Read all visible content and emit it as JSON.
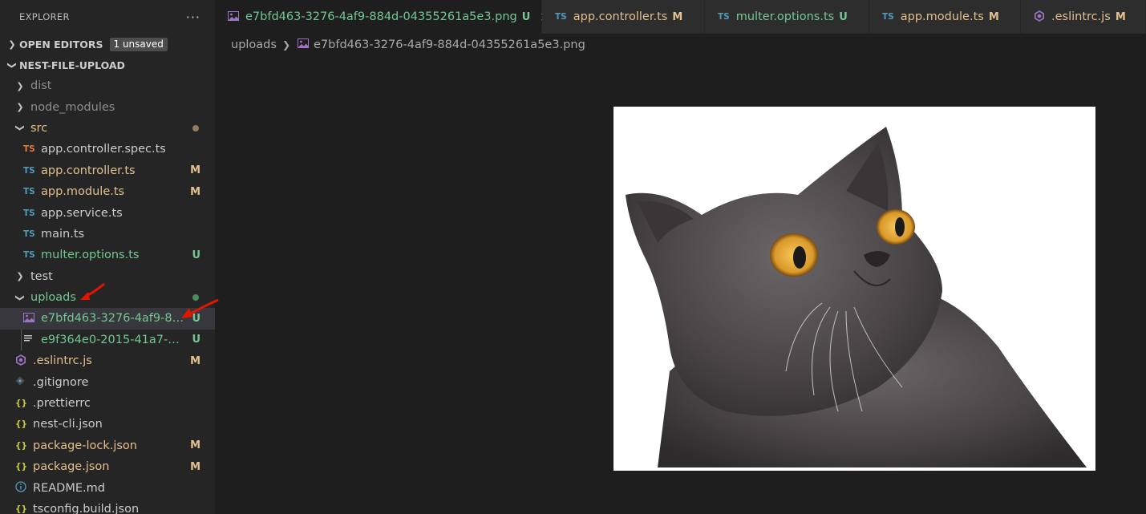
{
  "explorer": {
    "title": "EXPLORER",
    "more": "···",
    "open_editors": {
      "label": "OPEN EDITORS",
      "badge": "1 unsaved"
    },
    "project": {
      "label": "NEST-FILE-UPLOAD"
    },
    "tree": [
      {
        "label": "dist",
        "kind": "folder",
        "expanded": false
      },
      {
        "label": "node_modules",
        "kind": "folder",
        "expanded": false
      },
      {
        "label": "src",
        "kind": "folder",
        "expanded": true
      },
      {
        "label": "app.controller.spec.ts",
        "icon": "TS"
      },
      {
        "label": "app.controller.ts",
        "icon": "TS",
        "status": "M"
      },
      {
        "label": "app.module.ts",
        "icon": "TS",
        "status": "M"
      },
      {
        "label": "app.service.ts",
        "icon": "TS"
      },
      {
        "label": "main.ts",
        "icon": "TS"
      },
      {
        "label": "multer.options.ts",
        "icon": "TS",
        "status": "U"
      },
      {
        "label": "test",
        "kind": "folder",
        "expanded": false
      },
      {
        "label": "uploads",
        "kind": "folder",
        "expanded": true
      },
      {
        "label": "e7bfd463-3276-4af9-88...",
        "status": "U"
      },
      {
        "label": "e9f364e0-2015-41a7-ae...",
        "status": "U"
      },
      {
        "label": ".eslintrc.js",
        "status": "M"
      },
      {
        "label": ".gitignore"
      },
      {
        "label": ".prettierrc",
        "icon": "{}"
      },
      {
        "label": "nest-cli.json",
        "icon": "{}"
      },
      {
        "label": "package-lock.json",
        "icon": "{}",
        "status": "M"
      },
      {
        "label": "package.json",
        "icon": "{}",
        "status": "M"
      },
      {
        "label": "README.md"
      },
      {
        "label": "tsconfig.build.json",
        "icon": "{}"
      }
    ]
  },
  "tabs": [
    {
      "label": "e7bfd463-3276-4af9-884d-04355261a5e3.png",
      "status": "U",
      "active": true,
      "close": "✕"
    },
    {
      "label": "app.controller.ts",
      "icon": "TS",
      "status": "M"
    },
    {
      "label": "multer.options.ts",
      "icon": "TS",
      "status": "U"
    },
    {
      "label": "app.module.ts",
      "icon": "TS",
      "status": "M"
    },
    {
      "label": ".eslintrc.js",
      "status": "M"
    }
  ],
  "breadcrumb": {
    "folder": "uploads",
    "file": "e7bfd463-3276-4af9-884d-04355261a5e3.png"
  },
  "colors": {
    "modified": "#e2c08d",
    "untracked": "#73c991",
    "annotation_arrow": "#e51400"
  },
  "icons": {
    "image_file": "image-file-icon",
    "text_file": "text-file-icon",
    "git": "git-icon",
    "info": "info-icon",
    "eslint": "eslint-icon"
  }
}
